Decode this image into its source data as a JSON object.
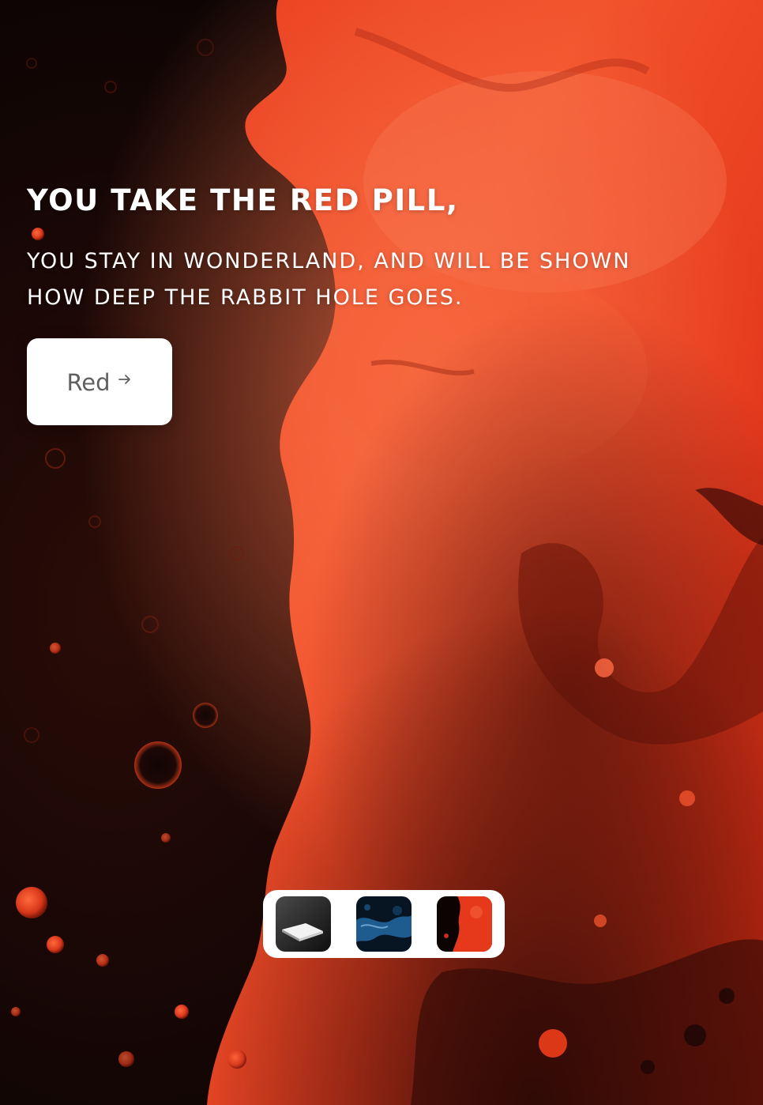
{
  "hero": {
    "title": "YOU TAKE THE RED PILL,",
    "subtitle": "YOU STAY IN WONDERLAND, AND WILL BE SHOWN HOW DEEP THE RABBIT HOLE GOES."
  },
  "cta": {
    "label": "Red",
    "icon": "arrow-right-icon"
  },
  "thumbnails": [
    {
      "name": "white-pill-thumbnail",
      "theme": "dark gray with white object"
    },
    {
      "name": "blue-pill-thumbnail",
      "theme": "dark blue fluid"
    },
    {
      "name": "red-pill-thumbnail",
      "theme": "red and black fluid"
    }
  ],
  "colors": {
    "accent_red": "#e8351c",
    "deep_red": "#b51d0e",
    "dark": "#0b0504",
    "button_bg": "#ffffff",
    "button_text": "#5f5f5f"
  }
}
